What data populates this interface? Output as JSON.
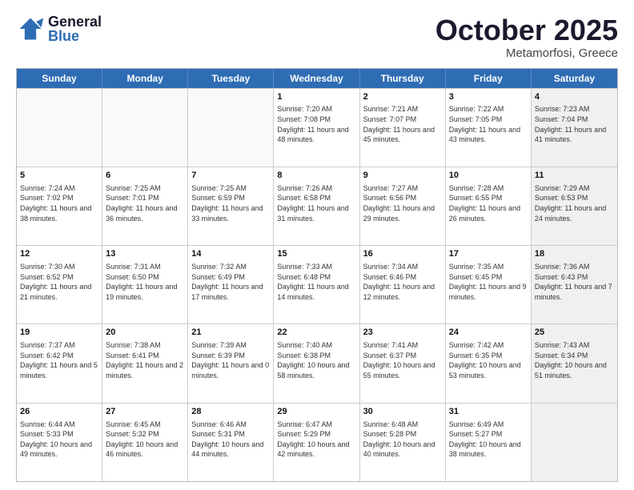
{
  "header": {
    "logo": {
      "general": "General",
      "blue": "Blue"
    },
    "month": "October 2025",
    "location": "Metamorfosi, Greece"
  },
  "weekdays": [
    "Sunday",
    "Monday",
    "Tuesday",
    "Wednesday",
    "Thursday",
    "Friday",
    "Saturday"
  ],
  "rows": [
    [
      {
        "day": "",
        "empty": true
      },
      {
        "day": "",
        "empty": true
      },
      {
        "day": "",
        "empty": true
      },
      {
        "day": "1",
        "sunrise": "7:20 AM",
        "sunset": "7:08 PM",
        "daylight": "11 hours and 48 minutes."
      },
      {
        "day": "2",
        "sunrise": "7:21 AM",
        "sunset": "7:07 PM",
        "daylight": "11 hours and 45 minutes."
      },
      {
        "day": "3",
        "sunrise": "7:22 AM",
        "sunset": "7:05 PM",
        "daylight": "11 hours and 43 minutes."
      },
      {
        "day": "4",
        "sunrise": "7:23 AM",
        "sunset": "7:04 PM",
        "daylight": "11 hours and 41 minutes.",
        "shaded": true
      }
    ],
    [
      {
        "day": "5",
        "sunrise": "7:24 AM",
        "sunset": "7:02 PM",
        "daylight": "11 hours and 38 minutes."
      },
      {
        "day": "6",
        "sunrise": "7:25 AM",
        "sunset": "7:01 PM",
        "daylight": "11 hours and 36 minutes."
      },
      {
        "day": "7",
        "sunrise": "7:25 AM",
        "sunset": "6:59 PM",
        "daylight": "11 hours and 33 minutes."
      },
      {
        "day": "8",
        "sunrise": "7:26 AM",
        "sunset": "6:58 PM",
        "daylight": "11 hours and 31 minutes."
      },
      {
        "day": "9",
        "sunrise": "7:27 AM",
        "sunset": "6:56 PM",
        "daylight": "11 hours and 29 minutes."
      },
      {
        "day": "10",
        "sunrise": "7:28 AM",
        "sunset": "6:55 PM",
        "daylight": "11 hours and 26 minutes."
      },
      {
        "day": "11",
        "sunrise": "7:29 AM",
        "sunset": "6:53 PM",
        "daylight": "11 hours and 24 minutes.",
        "shaded": true
      }
    ],
    [
      {
        "day": "12",
        "sunrise": "7:30 AM",
        "sunset": "6:52 PM",
        "daylight": "11 hours and 21 minutes."
      },
      {
        "day": "13",
        "sunrise": "7:31 AM",
        "sunset": "6:50 PM",
        "daylight": "11 hours and 19 minutes."
      },
      {
        "day": "14",
        "sunrise": "7:32 AM",
        "sunset": "6:49 PM",
        "daylight": "11 hours and 17 minutes."
      },
      {
        "day": "15",
        "sunrise": "7:33 AM",
        "sunset": "6:48 PM",
        "daylight": "11 hours and 14 minutes."
      },
      {
        "day": "16",
        "sunrise": "7:34 AM",
        "sunset": "6:46 PM",
        "daylight": "11 hours and 12 minutes."
      },
      {
        "day": "17",
        "sunrise": "7:35 AM",
        "sunset": "6:45 PM",
        "daylight": "11 hours and 9 minutes."
      },
      {
        "day": "18",
        "sunrise": "7:36 AM",
        "sunset": "6:43 PM",
        "daylight": "11 hours and 7 minutes.",
        "shaded": true
      }
    ],
    [
      {
        "day": "19",
        "sunrise": "7:37 AM",
        "sunset": "6:42 PM",
        "daylight": "11 hours and 5 minutes."
      },
      {
        "day": "20",
        "sunrise": "7:38 AM",
        "sunset": "6:41 PM",
        "daylight": "11 hours and 2 minutes."
      },
      {
        "day": "21",
        "sunrise": "7:39 AM",
        "sunset": "6:39 PM",
        "daylight": "11 hours and 0 minutes."
      },
      {
        "day": "22",
        "sunrise": "7:40 AM",
        "sunset": "6:38 PM",
        "daylight": "10 hours and 58 minutes."
      },
      {
        "day": "23",
        "sunrise": "7:41 AM",
        "sunset": "6:37 PM",
        "daylight": "10 hours and 55 minutes."
      },
      {
        "day": "24",
        "sunrise": "7:42 AM",
        "sunset": "6:35 PM",
        "daylight": "10 hours and 53 minutes."
      },
      {
        "day": "25",
        "sunrise": "7:43 AM",
        "sunset": "6:34 PM",
        "daylight": "10 hours and 51 minutes.",
        "shaded": true
      }
    ],
    [
      {
        "day": "26",
        "sunrise": "6:44 AM",
        "sunset": "5:33 PM",
        "daylight": "10 hours and 49 minutes."
      },
      {
        "day": "27",
        "sunrise": "6:45 AM",
        "sunset": "5:32 PM",
        "daylight": "10 hours and 46 minutes."
      },
      {
        "day": "28",
        "sunrise": "6:46 AM",
        "sunset": "5:31 PM",
        "daylight": "10 hours and 44 minutes."
      },
      {
        "day": "29",
        "sunrise": "6:47 AM",
        "sunset": "5:29 PM",
        "daylight": "10 hours and 42 minutes."
      },
      {
        "day": "30",
        "sunrise": "6:48 AM",
        "sunset": "5:28 PM",
        "daylight": "10 hours and 40 minutes."
      },
      {
        "day": "31",
        "sunrise": "6:49 AM",
        "sunset": "5:27 PM",
        "daylight": "10 hours and 38 minutes."
      },
      {
        "day": "",
        "empty": true,
        "shaded": true
      }
    ]
  ]
}
